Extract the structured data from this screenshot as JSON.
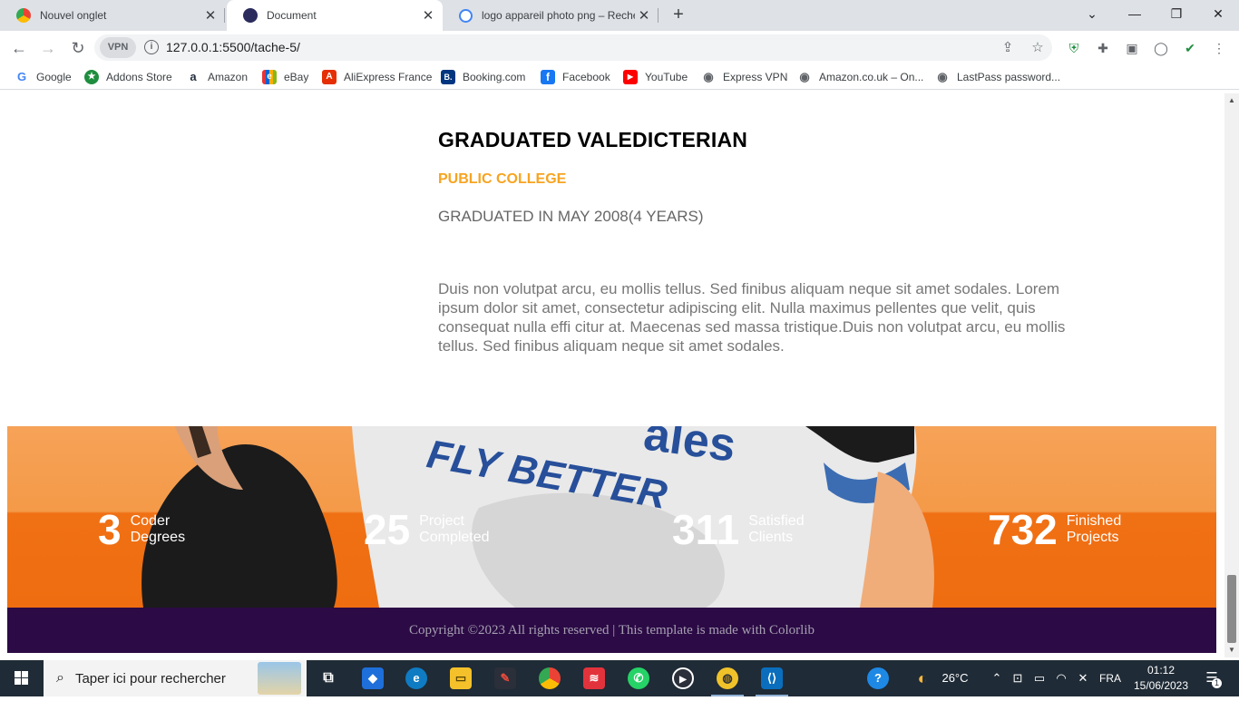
{
  "browser": {
    "tabs": [
      {
        "title": "Nouvel onglet",
        "active": false
      },
      {
        "title": "Document",
        "active": true
      },
      {
        "title": "logo appareil photo png – Reche",
        "active": false
      }
    ],
    "new_tab": "+",
    "url": "127.0.0.1:5500/tache-5/",
    "vpn_label": "VPN",
    "bookmarks": [
      {
        "label": "Google",
        "color": "#4285f4",
        "glyph": "G"
      },
      {
        "label": "Addons Store",
        "color": "#1e8e3e",
        "glyph": "★"
      },
      {
        "label": "Amazon",
        "color": "#232f3e",
        "glyph": "a"
      },
      {
        "label": "eBay",
        "color": "#e53238",
        "glyph": "e"
      },
      {
        "label": "AliExpress France",
        "color": "#e62e04",
        "glyph": "A"
      },
      {
        "label": "Booking.com",
        "color": "#003580",
        "glyph": "B."
      },
      {
        "label": "Facebook",
        "color": "#1877f2",
        "glyph": "f"
      },
      {
        "label": "YouTube",
        "color": "#ff0000",
        "glyph": "▶"
      },
      {
        "label": "Express VPN",
        "color": "#5f6368",
        "glyph": "◉"
      },
      {
        "label": "Amazon.co.uk – On...",
        "color": "#5f6368",
        "glyph": "◉"
      },
      {
        "label": "LastPass password...",
        "color": "#5f6368",
        "glyph": "◉"
      }
    ]
  },
  "resume": {
    "title": "GRADUATED VALEDICTERIAN",
    "school": "PUBLIC COLLEGE",
    "graduated": "GRADUATED IN MAY 2008(4 YEARS)",
    "description": "Duis non volutpat arcu, eu mollis tellus. Sed finibus aliquam neque sit amet sodales. Lorem ipsum dolor sit amet, consectetur adipiscing elit. Nulla maximus pellentes que velit, quis consequat nulla effi citur at. Maecenas sed massa tristique.Duis non volutpat arcu, eu mollis tellus. Sed finibus aliquam neque sit amet sodales."
  },
  "counters": [
    {
      "number": "3",
      "label": "Coder Degrees"
    },
    {
      "number": "25",
      "label": "Project Completed"
    },
    {
      "number": "311",
      "label": "Satisfied Clients"
    },
    {
      "number": "732",
      "label": "Finished Projects"
    }
  ],
  "banner_text": {
    "line1": "ales",
    "line2": "FLY BETTER"
  },
  "footer": {
    "copyright": "Copyright ©2023 All rights reserved | This template is made with Colorlib"
  },
  "taskbar": {
    "search_placeholder": "Taper ici pour rechercher",
    "weather": "26°C",
    "language": "FRA",
    "time": "01:12",
    "date": "15/06/2023",
    "notification_count": "1"
  },
  "colors": {
    "accent_orange": "#f7a421",
    "banner_orange": "#ee6d10",
    "footer_purple": "#2b0a45"
  }
}
